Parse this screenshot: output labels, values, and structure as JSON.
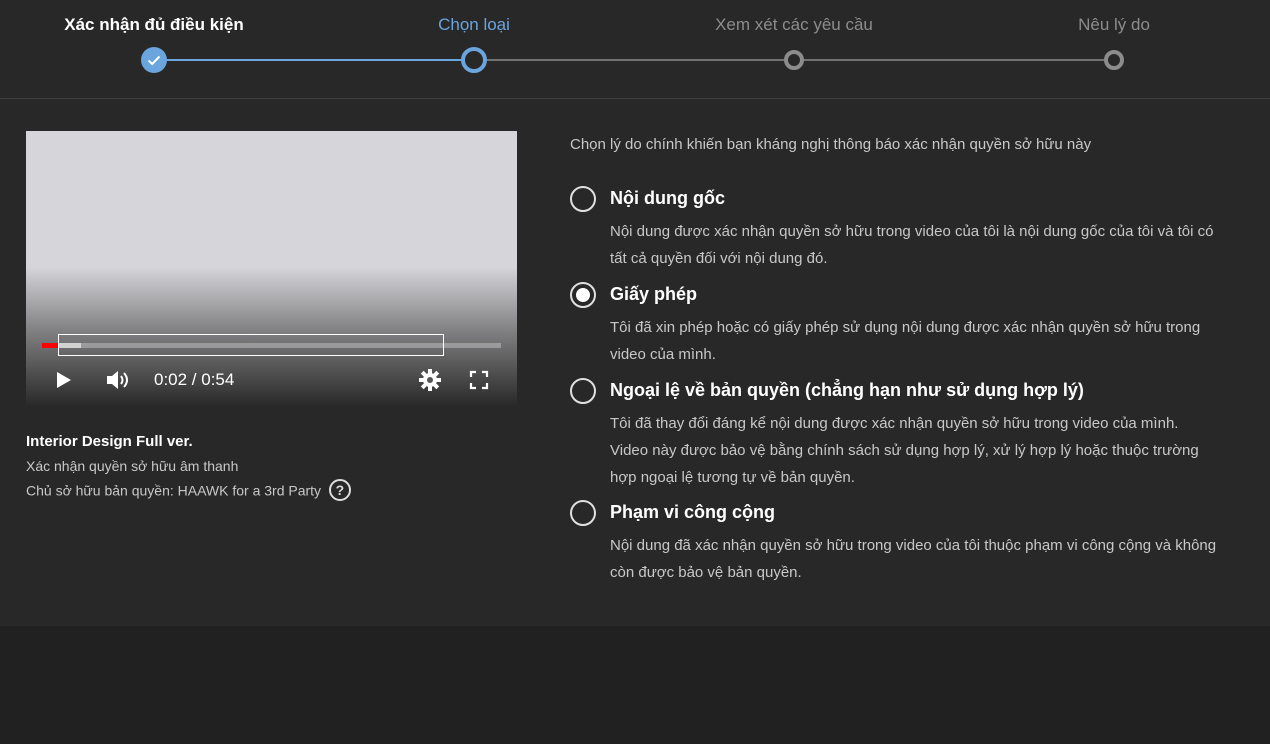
{
  "stepper": {
    "steps": [
      {
        "label": "Xác nhận đủ điều kiện",
        "state": "done"
      },
      {
        "label": "Chọn loại",
        "state": "current"
      },
      {
        "label": "Xem xét các yêu cầu",
        "state": "todo"
      },
      {
        "label": "Nêu lý do",
        "state": "todo"
      }
    ]
  },
  "player": {
    "time_display": "0:02 / 0:54",
    "progress_fraction": 0.037,
    "buffered_fraction": 0.085
  },
  "video_info": {
    "title": "Interior Design Full ver.",
    "claim_type": "Xác nhận quyền sở hữu âm thanh",
    "owner": "Chủ sở hữu bản quyền: HAAWK for a 3rd Party",
    "help_glyph": "?"
  },
  "reasons": {
    "prompt": "Chọn lý do chính khiến bạn kháng nghị thông báo xác nhận quyền sở hữu này",
    "options": [
      {
        "title": "Nội dung gốc",
        "description": "Nội dung được xác nhận quyền sở hữu trong video của tôi là nội dung gốc của tôi và tôi có tất cả quyền đối với nội dung đó.",
        "selected": false
      },
      {
        "title": "Giấy phép",
        "description": "Tôi đã xin phép hoặc có giấy phép sử dụng nội dung được xác nhận quyền sở hữu trong video của mình.",
        "selected": true
      },
      {
        "title": "Ngoại lệ về bản quyền (chẳng hạn như sử dụng hợp lý)",
        "description": "Tôi đã thay đổi đáng kể nội dung được xác nhận quyền sở hữu trong video của mình. Video này được bảo vệ bằng chính sách sử dụng hợp lý, xử lý hợp lý hoặc thuộc trường hợp ngoại lệ tương tự về bản quyền.",
        "selected": false
      },
      {
        "title": "Phạm vi công cộng",
        "description": "Nội dung đã xác nhận quyền sở hữu trong video của tôi thuộc phạm vi công cộng và không còn được bảo vệ bản quyền.",
        "selected": false
      }
    ]
  },
  "colors": {
    "accent": "#6aa5dd",
    "panel_bg": "#282828",
    "page_bg": "#212121",
    "progress_red": "#ff0000"
  },
  "icons": {
    "step_done": "check-icon",
    "play": "play-icon",
    "volume": "volume-icon",
    "settings": "gear-icon",
    "fullscreen": "fullscreen-icon",
    "help": "help-circle-icon"
  }
}
